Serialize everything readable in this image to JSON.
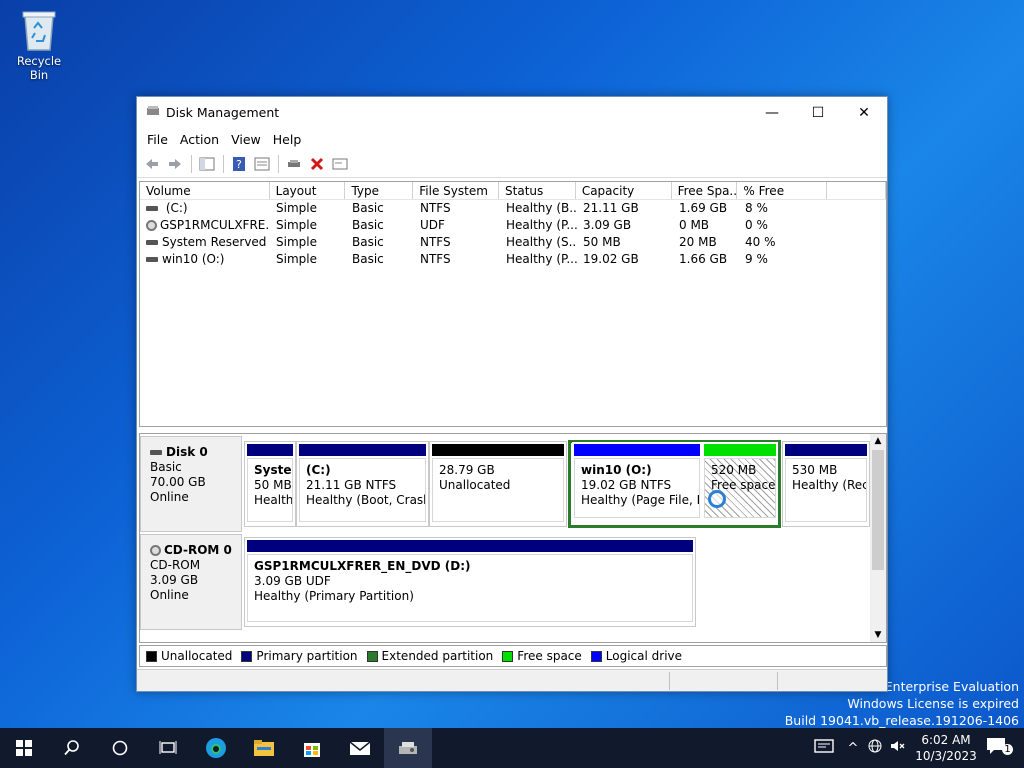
{
  "desktop": {
    "recycle_bin_label": "Recycle Bin",
    "watermark": [
      "s 10 Enterprise Evaluation",
      "Windows License is expired",
      "Build 19041.vb_release.191206-1406"
    ]
  },
  "window": {
    "title": "Disk Management",
    "controls": {
      "minimize": "—",
      "maximize": "☐",
      "close": "✕"
    }
  },
  "menu": [
    "File",
    "Action",
    "View",
    "Help"
  ],
  "volume_list": {
    "columns": [
      "Volume",
      "Layout",
      "Type",
      "File System",
      "Status",
      "Capacity",
      "Free Spa...",
      "% Free",
      ""
    ],
    "rows": [
      {
        "volume": " (C:)",
        "layout": "Simple",
        "type": "Basic",
        "fs": "NTFS",
        "status": "Healthy (B...",
        "capacity": "21.11 GB",
        "free": "1.69 GB",
        "pct": "8 %",
        "icon": "drive"
      },
      {
        "volume": "GSP1RMCULXFRE...",
        "layout": "Simple",
        "type": "Basic",
        "fs": "UDF",
        "status": "Healthy (P...",
        "capacity": "3.09 GB",
        "free": "0 MB",
        "pct": "0 %",
        "icon": "cd"
      },
      {
        "volume": "System Reserved",
        "layout": "Simple",
        "type": "Basic",
        "fs": "NTFS",
        "status": "Healthy (S...",
        "capacity": "50 MB",
        "free": "20 MB",
        "pct": "40 %",
        "icon": "drive"
      },
      {
        "volume": "win10 (O:)",
        "layout": "Simple",
        "type": "Basic",
        "fs": "NTFS",
        "status": "Healthy (P...",
        "capacity": "19.02 GB",
        "free": "1.66 GB",
        "pct": "9 %",
        "icon": "drive"
      }
    ]
  },
  "disks": [
    {
      "name": "Disk 0",
      "kind": "Basic",
      "size": "70.00 GB",
      "state": "Online",
      "partitions": [
        {
          "title": "Systen",
          "line2": "50 MB",
          "line3": "Healthy",
          "bar": "#00007f"
        },
        {
          "title": " (C:)",
          "line2": "21.11 GB NTFS",
          "line3": "Healthy (Boot, Crash D",
          "bar": "#00007f"
        },
        {
          "title": "",
          "line2": "28.79 GB",
          "line3": "Unallocated",
          "bar": "#000000"
        },
        {
          "title": "win10  (O:)",
          "line2": "19.02 GB NTFS",
          "line3": "Healthy (Page File, Lc",
          "bar": "#0000ff"
        },
        {
          "title": "",
          "line2": "520 MB",
          "line3": "Free space",
          "bar": "#00e000"
        },
        {
          "title": "",
          "line2": "530 MB",
          "line3": "Healthy (Recc",
          "bar": "#00007f"
        }
      ]
    },
    {
      "name": "CD-ROM 0",
      "kind": "CD-ROM",
      "size": "3.09 GB",
      "state": "Online",
      "partitions": [
        {
          "title": "GSP1RMCULXFRER_EN_DVD  (D:)",
          "line2": "3.09 GB UDF",
          "line3": "Healthy (Primary Partition)",
          "bar": "#00007f"
        }
      ]
    }
  ],
  "legend": [
    {
      "label": "Unallocated",
      "color": "#000000"
    },
    {
      "label": "Primary partition",
      "color": "#00007f"
    },
    {
      "label": "Extended partition",
      "color": "#2c7a2c"
    },
    {
      "label": "Free space",
      "color": "#00e000"
    },
    {
      "label": "Logical drive",
      "color": "#0000ff"
    }
  ],
  "taskbar": {
    "time": "6:02 AM",
    "date": "10/3/2023",
    "notification_count": "1"
  }
}
